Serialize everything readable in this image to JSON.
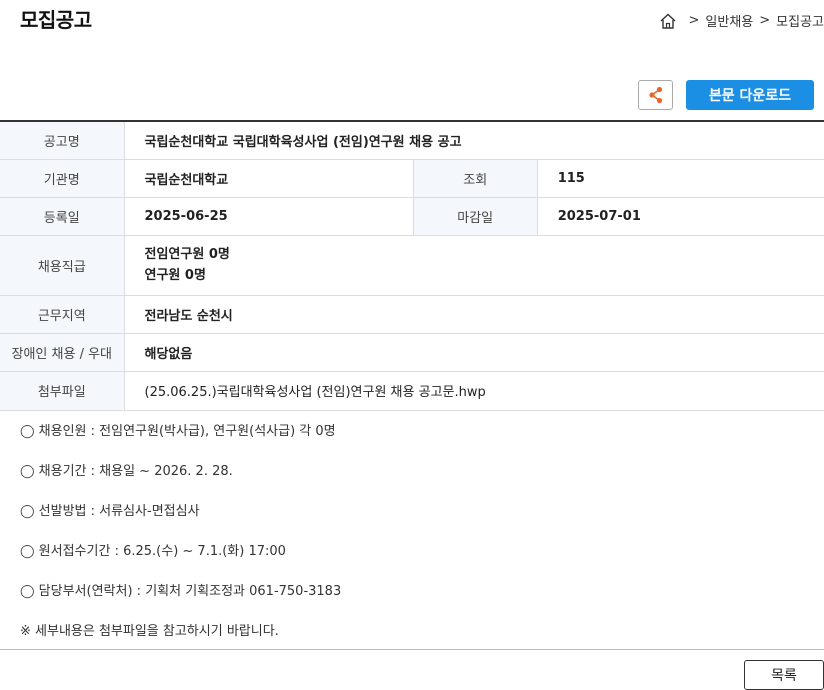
{
  "page": {
    "title": "모집공고"
  },
  "breadcrumb": {
    "items": [
      "일반채용",
      "모집공고"
    ],
    "separator": ">"
  },
  "toolbar": {
    "download_label": "본문 다운로드",
    "share_icon": "share-icon",
    "accent_color": "#1a8fe3",
    "share_color": "#e8652b"
  },
  "info": {
    "notice_name_label": "공고명",
    "notice_name": "국립순천대학교 국립대학육성사업 (전임)연구원 채용 공고",
    "org_label": "기관명",
    "org": "국립순천대학교",
    "views_label": "조회",
    "views": "115",
    "reg_date_label": "등록일",
    "reg_date": "2025-06-25",
    "deadline_label": "마감일",
    "deadline": "2025-07-01",
    "position_label": "채용직급",
    "positions": [
      "전임연구원 0명",
      "연구원 0명"
    ],
    "region_label": "근무지역",
    "region": "전라남도 순천시",
    "disability_label": "장애인 채용 / 우대",
    "disability": "해당없음",
    "attachment_label": "첨부파일",
    "attachment": "(25.06.25.)국립대학육성사업 (전임)연구원 채용 공고문.hwp"
  },
  "body": {
    "lines": [
      "◯ 채용인원 : 전임연구원(박사급), 연구원(석사급) 각 0명",
      "◯ 채용기간 : 채용일 ~ 2026. 2. 28.",
      "◯ 선발방법 : 서류심사-면접심사",
      "◯ 원서접수기간 : 6.25.(수) ~ 7.1.(화) 17:00",
      "◯ 담당부서(연락처) : 기획처 기획조정과 061-750-3183",
      "※ 세부내용은 첨부파일을 참고하시기 바랍니다."
    ]
  },
  "footer": {
    "list_label": "목록"
  }
}
